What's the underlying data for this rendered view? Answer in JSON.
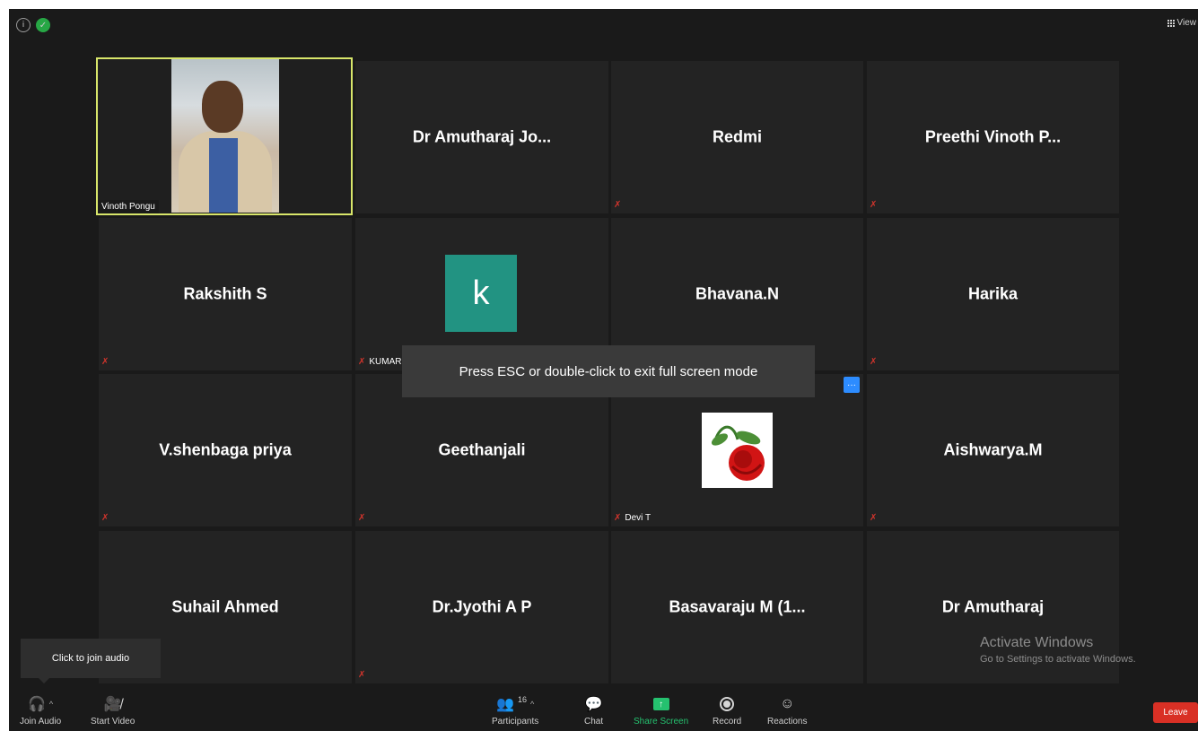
{
  "topbar": {
    "info_icon": "info-icon",
    "shield_icon": "shield-icon",
    "view_label": "View"
  },
  "participants": [
    {
      "name": "Vinoth Pongu",
      "type": "video",
      "active": true
    },
    {
      "name": "Dr Amutharaj Jo...",
      "muted": false
    },
    {
      "name": "Redmi",
      "muted": true
    },
    {
      "name": "Preethi Vinoth P...",
      "muted": true
    },
    {
      "name": "Rakshith S",
      "muted": true
    },
    {
      "name": "KUMAR H P",
      "type": "avatar",
      "avatar_letter": "k",
      "avatar_color": "#229382",
      "muted": true
    },
    {
      "name": "Bhavana.N",
      "muted": false
    },
    {
      "name": "Harika",
      "muted": true
    },
    {
      "name": "V.shenbaga priya",
      "muted": true
    },
    {
      "name": "Geethanjali",
      "muted": true
    },
    {
      "name": "Devi T",
      "type": "image",
      "image": "rose",
      "muted": true
    },
    {
      "name": "Aishwarya.M",
      "muted": true
    },
    {
      "name": "Suhail Ahmed",
      "muted": false
    },
    {
      "name": "Dr.Jyothi A P",
      "muted": true
    },
    {
      "name": "Basavaraju M (1...",
      "muted": false
    },
    {
      "name": "Dr Amutharaj",
      "muted": false
    }
  ],
  "fullscreen_toast": "Press ESC or double-click to exit full screen mode",
  "tooltip": "Click to join audio",
  "watermark": {
    "title": "Activate Windows",
    "subtitle": "Go to Settings to activate Windows."
  },
  "toolbar": {
    "join_audio": "Join Audio",
    "start_video": "Start Video",
    "participants": "Participants",
    "participants_count": "16",
    "chat": "Chat",
    "share_screen": "Share Screen",
    "record": "Record",
    "reactions": "Reactions",
    "leave": "Leave"
  },
  "colors": {
    "active_border": "#d8e66a",
    "share_green": "#25c16f",
    "leave_red": "#d93025",
    "mute_red": "#d0342c"
  }
}
